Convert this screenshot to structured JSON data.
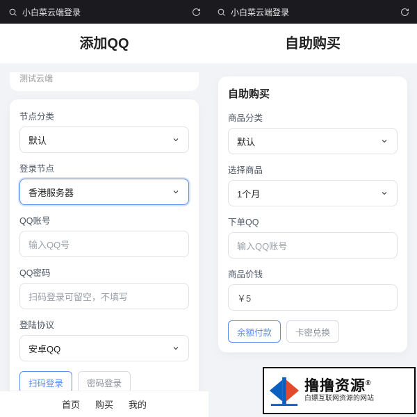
{
  "left": {
    "topbar_title": "小白菜云端登录",
    "header": "添加QQ",
    "cut_top_text": "测试云端",
    "node_category_label": "节点分类",
    "node_category_value": "默认",
    "login_node_label": "登录节点",
    "login_node_value": "香港服务器",
    "qq_account_label": "QQ账号",
    "qq_account_placeholder": "输入QQ号",
    "qq_password_label": "QQ密码",
    "qq_password_placeholder": "扫码登录可留空，不填写",
    "login_protocol_label": "登陆协议",
    "login_protocol_value": "安卓QQ",
    "scan_login_btn": "扫码登录",
    "password_login_btn": "密码登录",
    "nav": {
      "home": "首页",
      "buy": "购买",
      "mine": "我的"
    }
  },
  "right": {
    "topbar_title": "小白菜云端登录",
    "header": "自助购买",
    "card_title": "自助购买",
    "product_category_label": "商品分类",
    "product_category_value": "默认",
    "select_product_label": "选择商品",
    "select_product_value": "1个月",
    "order_qq_label": "下单QQ",
    "order_qq_placeholder": "输入QQ账号",
    "product_price_label": "商品价钱",
    "product_price_value": "￥5",
    "balance_pay_btn": "余额付款",
    "card_exchange_btn": "卡密兑换"
  },
  "watermark": {
    "brand": "撸撸资源",
    "reg": "®",
    "sub": "白嫖互联网资源的网站"
  }
}
